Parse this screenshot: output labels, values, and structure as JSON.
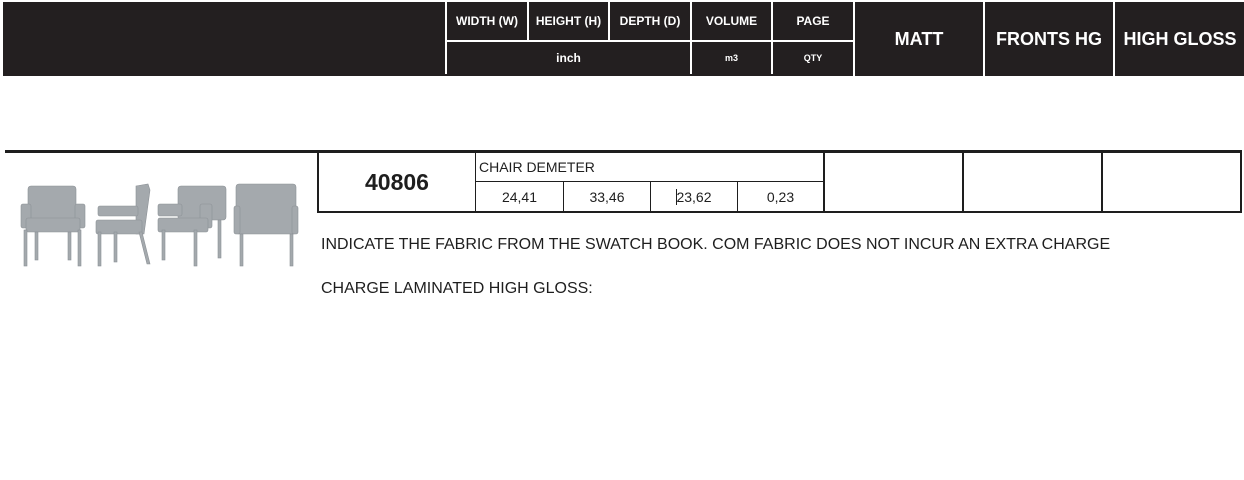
{
  "header": {
    "width_label": "WIDTH (W)",
    "height_label": "HEIGHT (H)",
    "depth_label": "DEPTH (D)",
    "volume_label": "VOLUME",
    "page_label": "PAGE",
    "unit_inch": "inch",
    "unit_m3": "m3",
    "unit_qty": "QTY",
    "col_matt": "MATT",
    "col_fronts_hg": "FRONTS HG",
    "col_high_gloss": "HIGH GLOSS"
  },
  "product": {
    "code": "40806",
    "name": "CHAIR DEMETER",
    "width": "24,41",
    "height": "33,46",
    "depth": "23,62",
    "volume": "0,23",
    "image_icon": "armchair-views-image"
  },
  "notes": {
    "fabric": "INDICATE THE FABRIC FROM THE SWATCH BOOK. COM FABRIC DOES NOT INCUR AN EXTRA CHARGE",
    "laminated": "CHARGE LAMINATED HIGH GLOSS:"
  },
  "colors": {
    "header_bg": "#231f20",
    "header_text": "#ffffff",
    "text": "#1e1e1e",
    "chair": "#a4a9ad"
  }
}
